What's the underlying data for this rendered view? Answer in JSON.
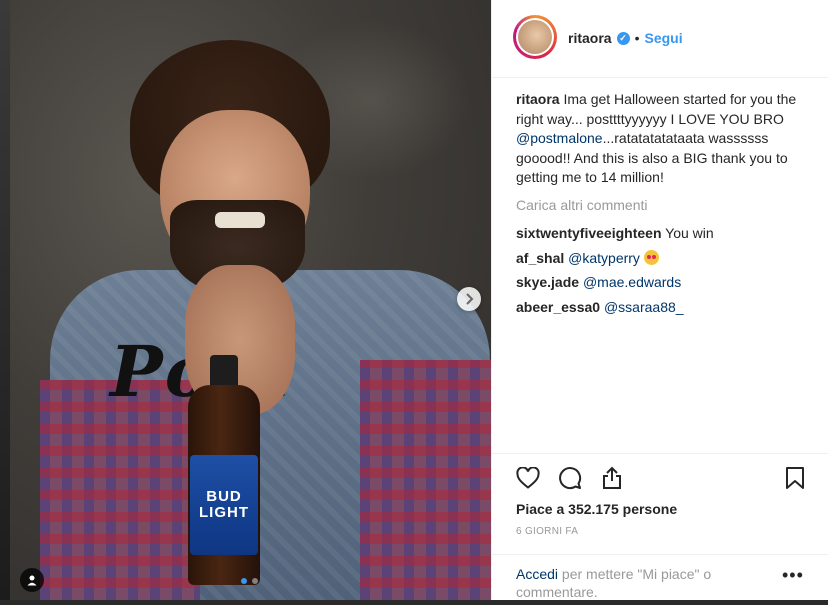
{
  "post": {
    "username": "ritaora",
    "follow_label": "Segui",
    "bullet": "•",
    "caption_user": "ritaora",
    "caption_text_1": " Ima get Halloween started for you the right way... posttttyyyyyy I LOVE YOU BRO ",
    "caption_mention": "@postmalone",
    "caption_text_2": "...ratatatatataata wassssss gooood!! And this is also a BIG thank you to getting me to 14 million!",
    "load_more": "Carica altri commenti",
    "comments": [
      {
        "user": "sixtwentyfiveeighteen",
        "text": " You win",
        "mention": ""
      },
      {
        "user": "af_shal",
        "text": " ",
        "mention": "@katyperry"
      },
      {
        "user": "skye.jade",
        "text": " ",
        "mention": "@mae.edwards"
      },
      {
        "user": "abeer_essa0",
        "text": " ",
        "mention": "@ssaraa88_"
      }
    ],
    "likes": "Piace a 352.175 persone",
    "date": "6 GIORNI FA",
    "login_link": "Accedi",
    "login_text": " per mettere \"Mi piace\" o commentare.",
    "more_label": "•••"
  },
  "photo": {
    "bottle_brand_1": "BUD",
    "bottle_brand_2": "LIGHT",
    "jacket_text": "Pom"
  },
  "icons": {
    "next": "chevron-right-icon",
    "like": "heart-icon",
    "comment": "comment-icon",
    "share": "share-icon",
    "save": "bookmark-icon",
    "tag": "user-tag-icon",
    "verified": "verified-badge-icon"
  },
  "colors": {
    "accent": "#3897f0",
    "link": "#003569",
    "muted": "#999999",
    "text": "#262626"
  }
}
